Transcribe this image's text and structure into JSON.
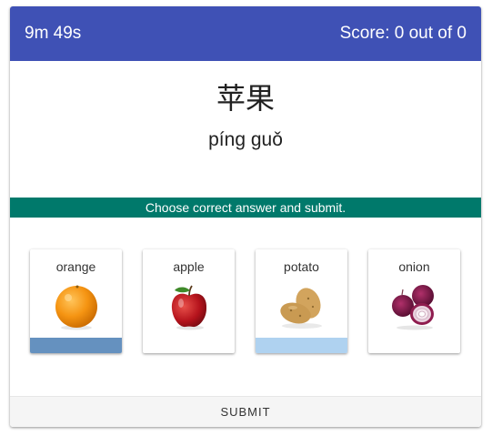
{
  "header": {
    "timer": "9m 49s",
    "score": "Score: 0 out of 0",
    "color": "#3f51b5"
  },
  "question": {
    "hanzi": "苹果",
    "pinyin": "píng guǒ"
  },
  "instruction": {
    "text": "Choose correct answer and submit.",
    "color": "#00796b"
  },
  "options": [
    {
      "label": "orange",
      "icon": "orange-image",
      "state": "selected",
      "bar_color": "#6591bf"
    },
    {
      "label": "apple",
      "icon": "apple-image",
      "state": "default",
      "bar_color": ""
    },
    {
      "label": "potato",
      "icon": "potato-image",
      "state": "highlighted",
      "bar_color": "#afd2f0"
    },
    {
      "label": "onion",
      "icon": "onion-image",
      "state": "default",
      "bar_color": ""
    }
  ],
  "submit": {
    "label": "SUBMIT"
  }
}
